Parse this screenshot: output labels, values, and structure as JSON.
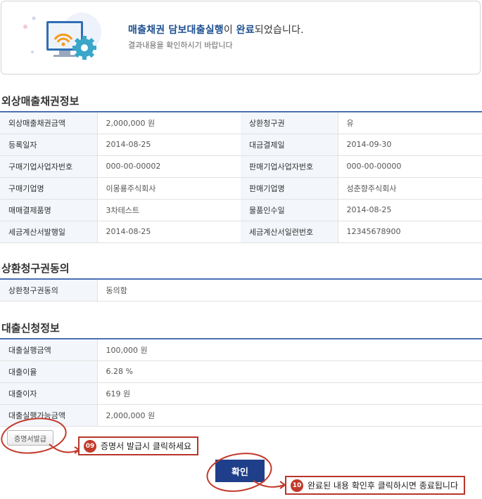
{
  "banner": {
    "msg_part1": "매출채권 담보대출실행",
    "msg_part2": "이 ",
    "msg_part3": "완료",
    "msg_part4": "되었습니다.",
    "sub": "결과내용을 확인하시기 바랍니다",
    "icon": "monitor-gear-icon"
  },
  "sections": {
    "receivables": {
      "title": "외상매출채권정보",
      "rows": [
        {
          "l1": "외상매출채권금액",
          "v1": "2,000,000 원",
          "l2": "상환청구권",
          "v2": "유"
        },
        {
          "l1": "등록일자",
          "v1": "2014-08-25",
          "l2": "대금결제일",
          "v2": "2014-09-30"
        },
        {
          "l1": "구매기업사업자번호",
          "v1": "000-00-00002",
          "l2": "판매기업사업자번호",
          "v2": "000-00-00000"
        },
        {
          "l1": "구매기업명",
          "v1": "이몽룡주식회사",
          "l2": "판매기업명",
          "v2": "성춘향주식회사"
        },
        {
          "l1": "매매결제품명",
          "v1": "3차테스트",
          "l2": "물품인수일",
          "v2": "2014-08-25"
        },
        {
          "l1": "세금계산서발행일",
          "v1": "2014-08-25",
          "l2": "세금계산서일련번호",
          "v2": "12345678900"
        }
      ]
    },
    "recourse": {
      "title": "상환청구권동의",
      "rows": [
        {
          "label": "상환청구권동의",
          "value": "동의함"
        }
      ]
    },
    "loan": {
      "title": "대출신청정보",
      "rows": [
        {
          "label": "대출실행금액",
          "value": "100,000 원"
        },
        {
          "label": "대출이율",
          "value": "6.28 %"
        },
        {
          "label": "대출이자",
          "value": "619 원"
        },
        {
          "label": "대출실행가능금액",
          "value": "2,000,000 원"
        }
      ]
    }
  },
  "buttons": {
    "certificate": "증명서발급",
    "confirm": "확인"
  },
  "callouts": {
    "c09": {
      "num": "09",
      "text": "증명서 발급시 클릭하세요"
    },
    "c10": {
      "num": "10",
      "text": "완료된 내용 확인후 클릭하시면 종료됩니다"
    }
  },
  "colors": {
    "accent": "#1d4f91",
    "table_line": "#4a6fb3",
    "callout": "#c23a2b",
    "confirm_bg": "#1f3f8a"
  }
}
